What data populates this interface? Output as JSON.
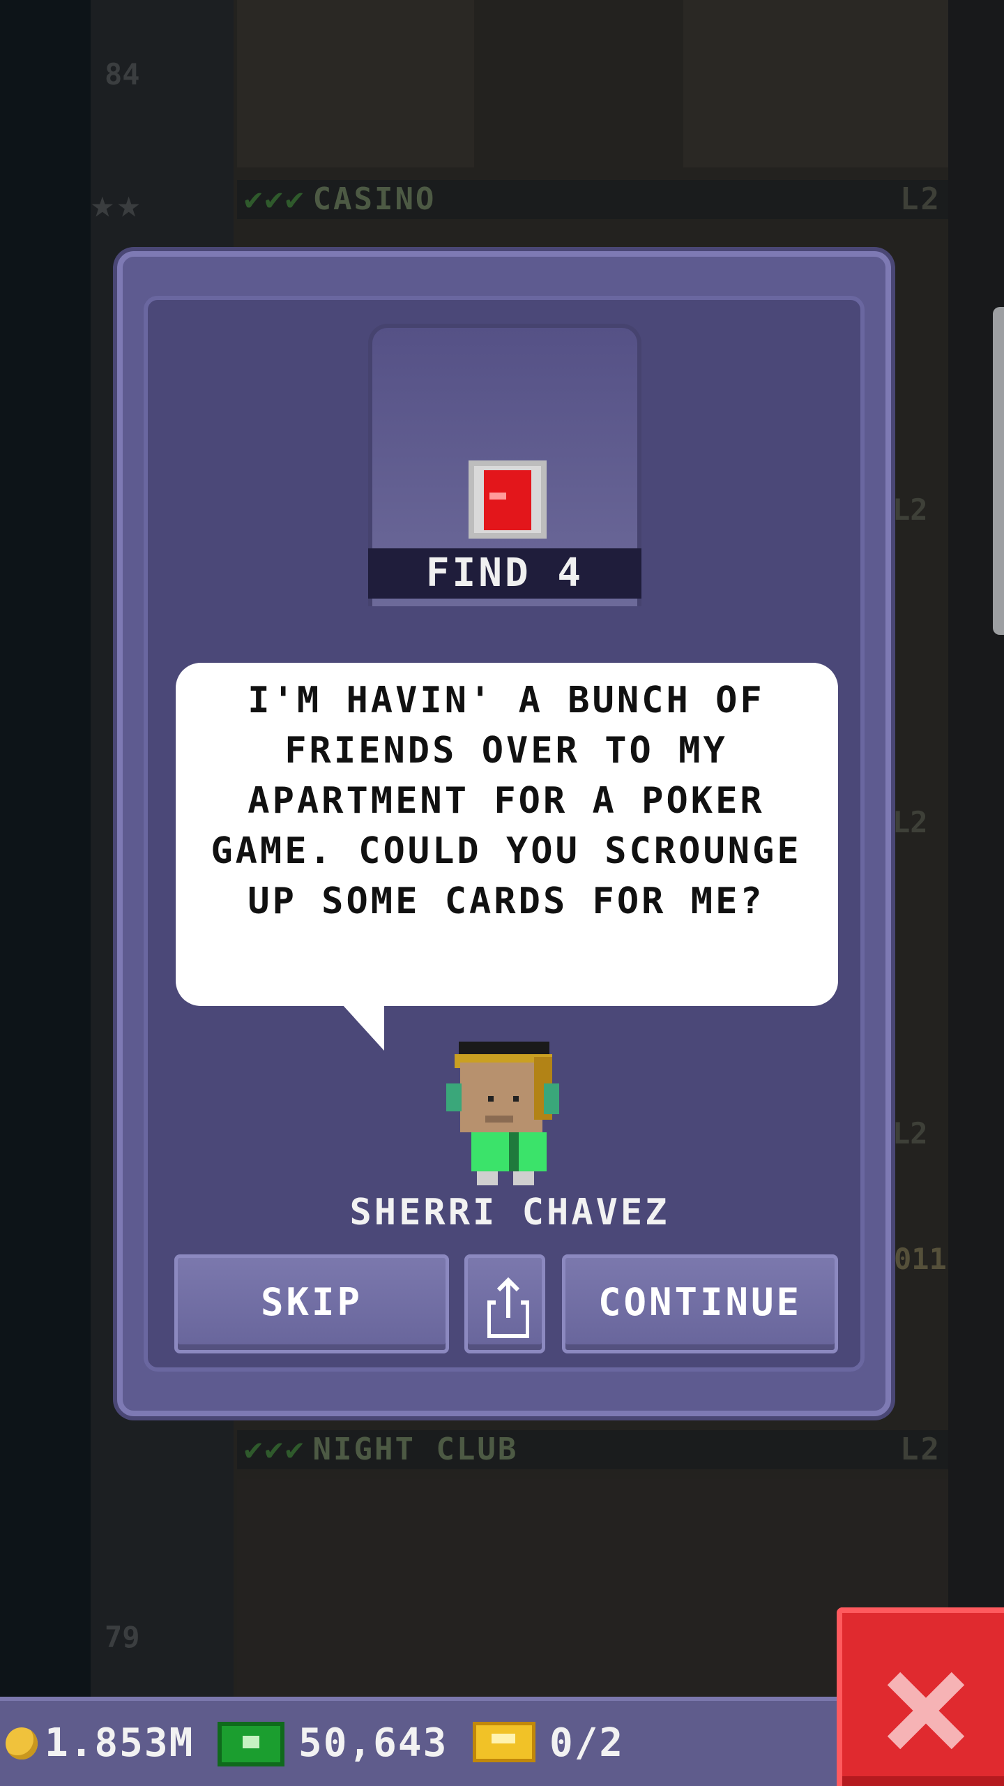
{
  "background": {
    "floor_numbers": [
      "84",
      "79"
    ],
    "floors": [
      {
        "name": "CASINO",
        "level": "L2"
      },
      {
        "name": "NIGHT CLUB",
        "level": "L2"
      }
    ],
    "side_levels": [
      "L2",
      "L2",
      "L2",
      "L2"
    ],
    "partial_room_number": "011"
  },
  "mission": {
    "task_label": "FIND 4",
    "item_icon": "playing-card-icon",
    "quote": "I'M HAVIN' A BUNCH OF FRIENDS OVER TO MY APARTMENT FOR A POKER GAME. COULD YOU SCROUNGE UP SOME CARDS FOR ME?",
    "npc_name": "SHERRI CHAVEZ",
    "buttons": {
      "skip": "SKIP",
      "share_icon": "share-icon",
      "continue": "CONTINUE"
    }
  },
  "hud": {
    "coins": "1.853M",
    "bux": "50,643",
    "tickets": "0/2"
  },
  "colors": {
    "dialog": "#5e5b90",
    "dialog_inner": "#4b4878",
    "close_button": "#e02a2f",
    "hud": "#5f5c8c"
  }
}
